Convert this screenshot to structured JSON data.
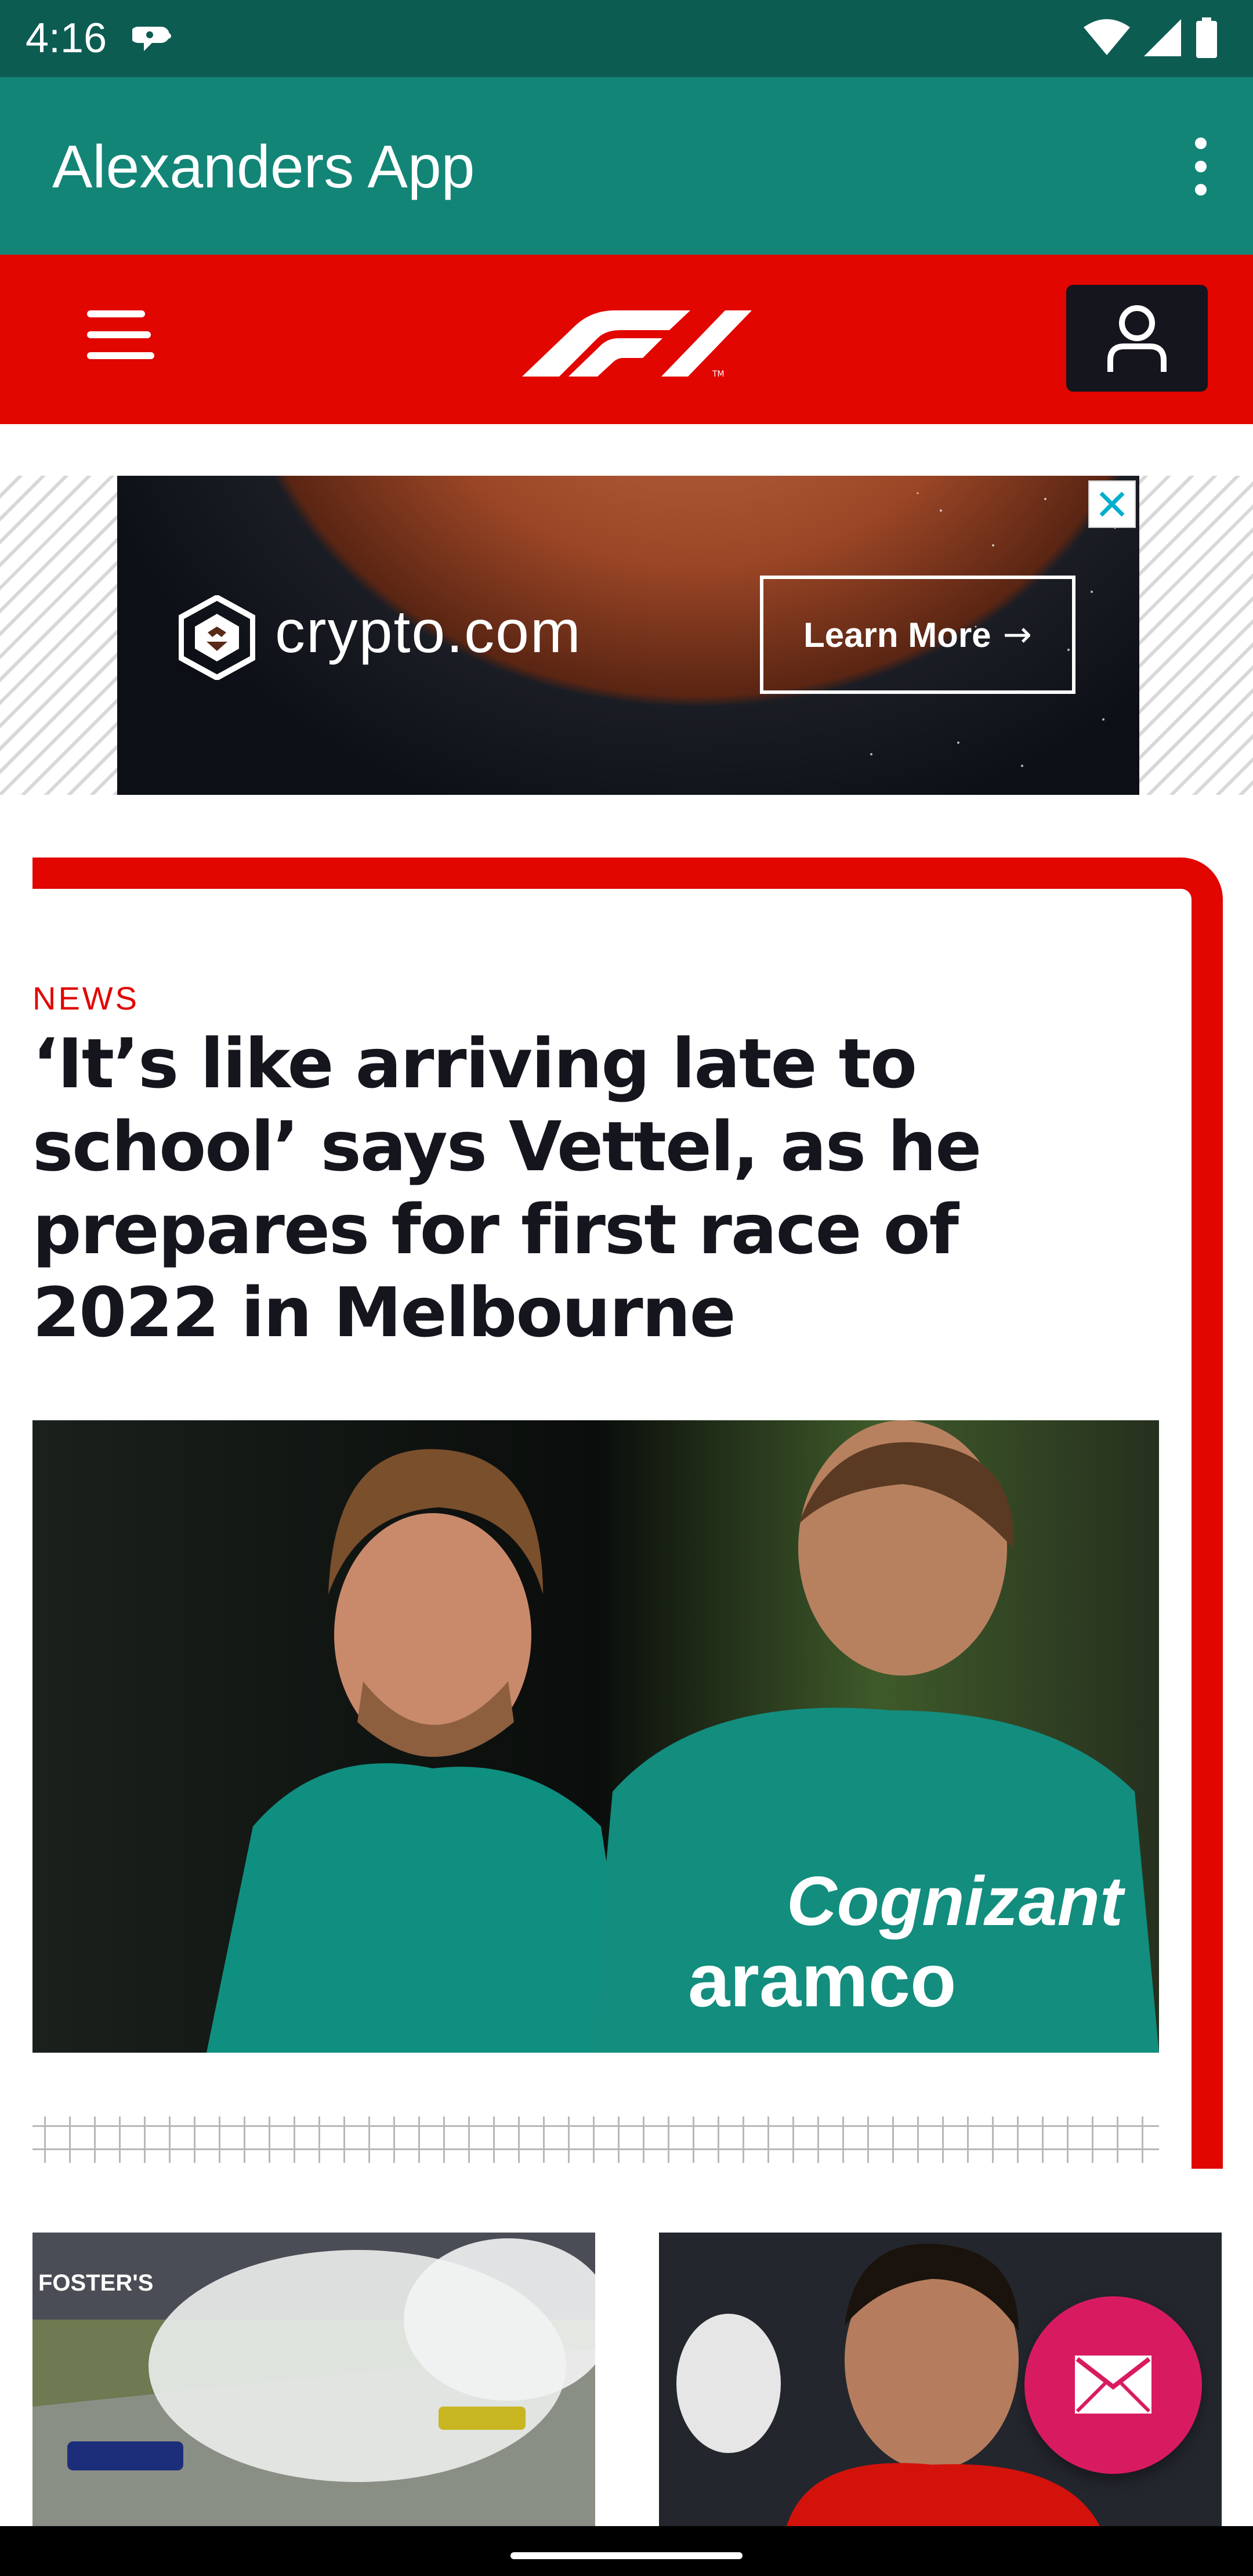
{
  "status_bar": {
    "time": "4:16",
    "icons": [
      "notification-icon",
      "wifi-icon",
      "signal-icon",
      "battery-icon"
    ]
  },
  "app_bar": {
    "title": "Alexanders App",
    "menu_icon": "more-vert-icon"
  },
  "f1_header": {
    "background_color": "#e10600",
    "menu_icon": "hamburger-menu-icon",
    "logo": "F1",
    "account_icon": "account-icon"
  },
  "ad": {
    "brand": "crypto.com",
    "cta_label": "Learn More",
    "cta_icon": "arrow-right-icon",
    "close_icon": "close-icon"
  },
  "article": {
    "category": "NEWS",
    "headline": "‘It’s like arriving late to school’ says Vettel, as he prepares for first race of 2022 in Melbourne",
    "image_subject": "sebastian-vettel-photo",
    "jersey_text_1": "Cognizant",
    "jersey_text_2": "aramco"
  },
  "related": [
    {
      "image_subject": "race-car-smoke-photo",
      "banner_text": "FOSTER'S"
    },
    {
      "image_subject": "driver-portrait-photo"
    }
  ],
  "fab": {
    "icon": "mail-icon",
    "color": "#d81b60"
  },
  "colors": {
    "status_bar": "#0d5c52",
    "app_bar": "#128577",
    "f1_red": "#e10600",
    "dark": "#15151e"
  }
}
